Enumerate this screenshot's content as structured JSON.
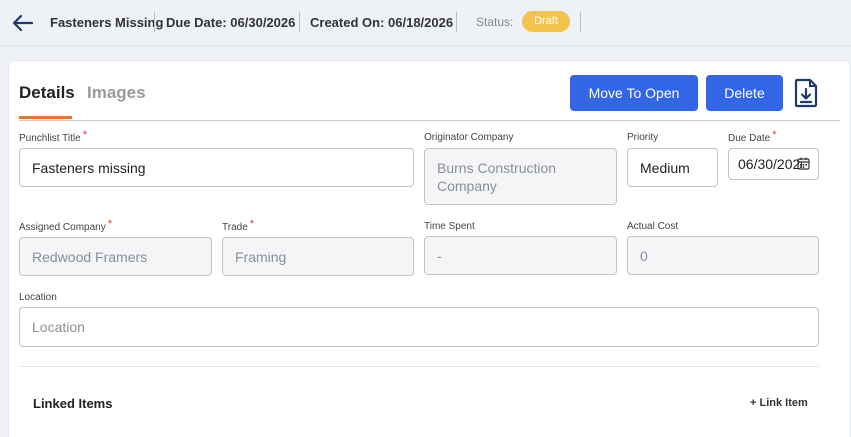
{
  "header": {
    "title": "Fasteners Missing",
    "due_date": "Due Date: 06/30/2026",
    "created_on": "Created On: 06/18/2026",
    "status_label": "Status:",
    "status_value": "Draft"
  },
  "tabs": [
    {
      "label": "Details",
      "active": true
    },
    {
      "label": "Images",
      "active": false
    }
  ],
  "actions": {
    "move_to_open": "Move To Open",
    "delete": "Delete"
  },
  "form": {
    "punchlist_title": {
      "label": "Punchlist Title",
      "required": "*",
      "value": "Fasteners missing"
    },
    "originator_company": {
      "label": "Originator Company",
      "value": "Burns Construction Company"
    },
    "priority": {
      "label": "Priority",
      "value": "Medium"
    },
    "due_date": {
      "label": "Due Date",
      "required": "*",
      "value": "06/30/2026"
    },
    "assigned_company": {
      "label": "Assigned Company",
      "required": "*",
      "value": "Redwood Framers"
    },
    "trade": {
      "label": "Trade",
      "required": "*",
      "value": "Framing"
    },
    "time_spent": {
      "label": "Time Spent",
      "value": "-"
    },
    "actual_cost": {
      "label": "Actual Cost",
      "value": "0"
    },
    "location": {
      "label": "Location",
      "placeholder": "Location"
    }
  },
  "linked_items": {
    "title": "Linked Items",
    "link_action": "+ Link Item"
  },
  "colors": {
    "primary": "#3366e6",
    "status_draft": "#f3c34b",
    "tab_accent": "#e87722",
    "required": "#e03b3b"
  }
}
